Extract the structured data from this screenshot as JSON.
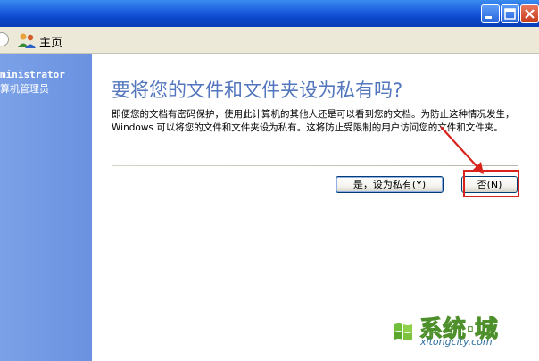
{
  "toolbar": {
    "home_label": "主页"
  },
  "user": {
    "name": "ministrator",
    "role": "算机管理员"
  },
  "dialog": {
    "heading": "要将您的文件和文件夹设为私有吗?",
    "description": "即便您的文档有密码保护，使用此计算机的其他人还是可以看到您的文档。为防止这种情况发生， Windows 可以将您的文件和文件夹设为私有。这将防止受限制的用户访问您的文件和文件夹。",
    "yes_button": "是，设为私有(Y)",
    "no_button": "否(N)"
  },
  "watermark": {
    "brand": "系统城",
    "url": "xitongcity.com"
  },
  "colors": {
    "titlebar": "#1d5fe0",
    "leftpane": "#7ba1e8",
    "heading": "#5476be",
    "highlight": "#d9221c"
  }
}
